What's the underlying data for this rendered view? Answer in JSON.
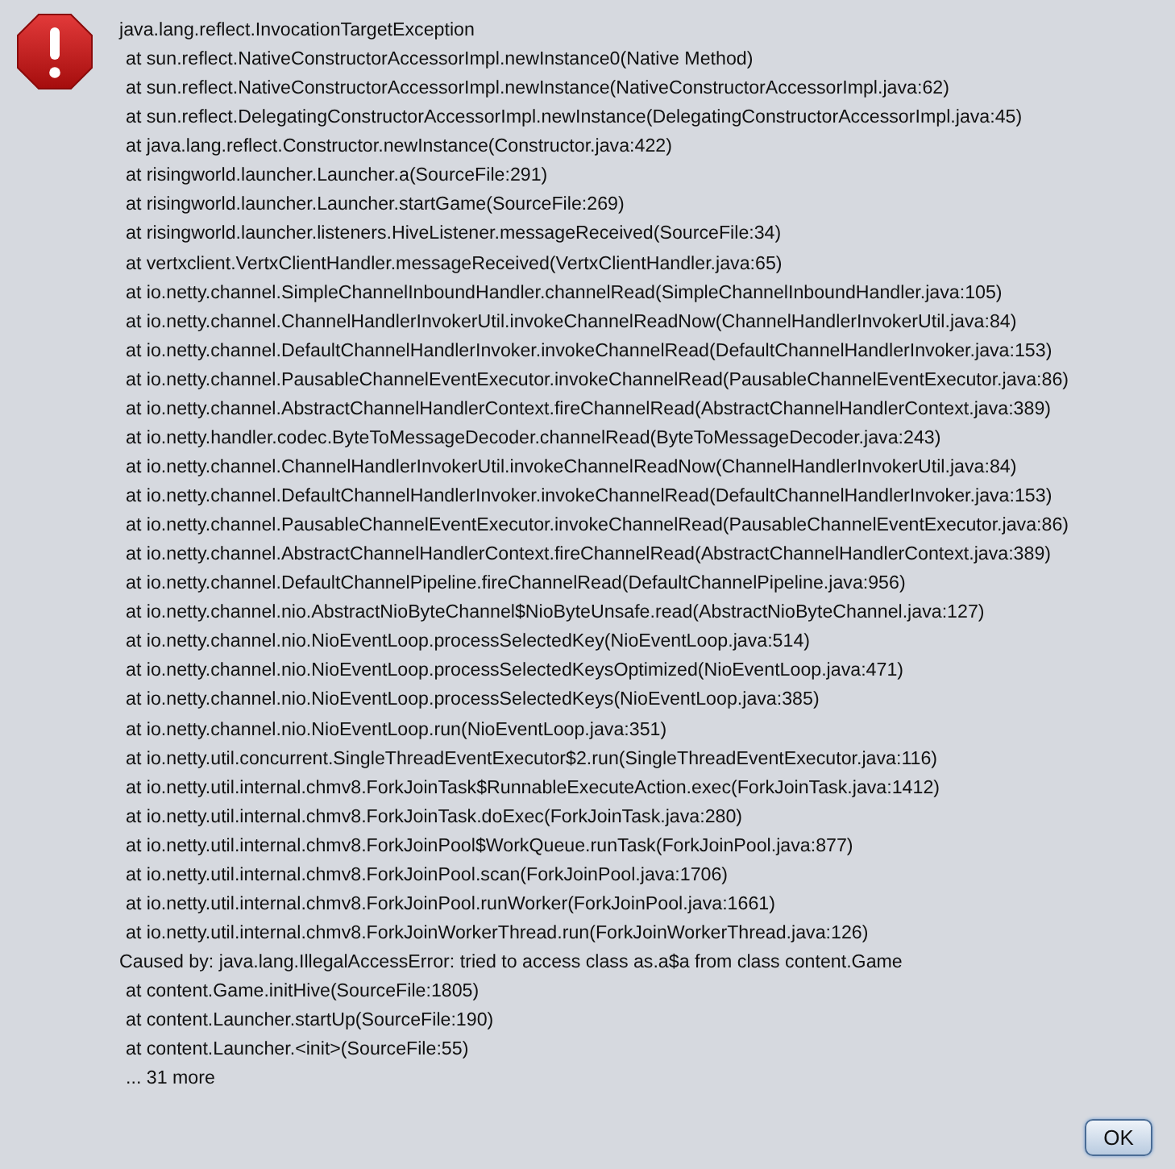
{
  "dialog": {
    "kind": "error",
    "lines": [
      {
        "kind": "exception",
        "text": "java.lang.reflect.InvocationTargetException"
      },
      {
        "kind": "frame",
        "text": "at sun.reflect.NativeConstructorAccessorImpl.newInstance0(Native Method)"
      },
      {
        "kind": "frame",
        "text": "at sun.reflect.NativeConstructorAccessorImpl.newInstance(NativeConstructorAccessorImpl.java:62)"
      },
      {
        "kind": "frame",
        "text": "at sun.reflect.DelegatingConstructorAccessorImpl.newInstance(DelegatingConstructorAccessorImpl.java:45)"
      },
      {
        "kind": "frame",
        "text": "at java.lang.reflect.Constructor.newInstance(Constructor.java:422)"
      },
      {
        "kind": "frame",
        "text": "at risingworld.launcher.Launcher.a(SourceFile:291)"
      },
      {
        "kind": "frame",
        "text": "at risingworld.launcher.Launcher.startGame(SourceFile:269)"
      },
      {
        "kind": "frame",
        "text": "at risingworld.launcher.listeners.HiveListener.messageReceived(SourceFile:34)"
      },
      {
        "kind": "frame",
        "text": "at vertxclient.VertxClientHandler.messageReceived(VertxClientHandler.java:65)"
      },
      {
        "kind": "frame",
        "text": "at io.netty.channel.SimpleChannelInboundHandler.channelRead(SimpleChannelInboundHandler.java:105)"
      },
      {
        "kind": "frame",
        "text": "at io.netty.channel.ChannelHandlerInvokerUtil.invokeChannelReadNow(ChannelHandlerInvokerUtil.java:84)"
      },
      {
        "kind": "frame",
        "text": "at io.netty.channel.DefaultChannelHandlerInvoker.invokeChannelRead(DefaultChannelHandlerInvoker.java:153)"
      },
      {
        "kind": "frame",
        "text": "at io.netty.channel.PausableChannelEventExecutor.invokeChannelRead(PausableChannelEventExecutor.java:86)"
      },
      {
        "kind": "frame",
        "text": "at io.netty.channel.AbstractChannelHandlerContext.fireChannelRead(AbstractChannelHandlerContext.java:389)"
      },
      {
        "kind": "frame",
        "text": "at io.netty.handler.codec.ByteToMessageDecoder.channelRead(ByteToMessageDecoder.java:243)"
      },
      {
        "kind": "frame",
        "text": "at io.netty.channel.ChannelHandlerInvokerUtil.invokeChannelReadNow(ChannelHandlerInvokerUtil.java:84)"
      },
      {
        "kind": "frame",
        "text": "at io.netty.channel.DefaultChannelHandlerInvoker.invokeChannelRead(DefaultChannelHandlerInvoker.java:153)"
      },
      {
        "kind": "frame",
        "text": "at io.netty.channel.PausableChannelEventExecutor.invokeChannelRead(PausableChannelEventExecutor.java:86)"
      },
      {
        "kind": "frame",
        "text": "at io.netty.channel.AbstractChannelHandlerContext.fireChannelRead(AbstractChannelHandlerContext.java:389)"
      },
      {
        "kind": "frame",
        "text": "at io.netty.channel.DefaultChannelPipeline.fireChannelRead(DefaultChannelPipeline.java:956)"
      },
      {
        "kind": "frame",
        "text": "at io.netty.channel.nio.AbstractNioByteChannel$NioByteUnsafe.read(AbstractNioByteChannel.java:127)"
      },
      {
        "kind": "frame",
        "text": "at io.netty.channel.nio.NioEventLoop.processSelectedKey(NioEventLoop.java:514)"
      },
      {
        "kind": "frame",
        "text": "at io.netty.channel.nio.NioEventLoop.processSelectedKeysOptimized(NioEventLoop.java:471)"
      },
      {
        "kind": "frame",
        "text": "at io.netty.channel.nio.NioEventLoop.processSelectedKeys(NioEventLoop.java:385)"
      },
      {
        "kind": "frame",
        "text": "at io.netty.channel.nio.NioEventLoop.run(NioEventLoop.java:351)"
      },
      {
        "kind": "frame",
        "text": "at io.netty.util.concurrent.SingleThreadEventExecutor$2.run(SingleThreadEventExecutor.java:116)"
      },
      {
        "kind": "frame",
        "text": "at io.netty.util.internal.chmv8.ForkJoinTask$RunnableExecuteAction.exec(ForkJoinTask.java:1412)"
      },
      {
        "kind": "frame",
        "text": "at io.netty.util.internal.chmv8.ForkJoinTask.doExec(ForkJoinTask.java:280)"
      },
      {
        "kind": "frame",
        "text": "at io.netty.util.internal.chmv8.ForkJoinPool$WorkQueue.runTask(ForkJoinPool.java:877)"
      },
      {
        "kind": "frame",
        "text": "at io.netty.util.internal.chmv8.ForkJoinPool.scan(ForkJoinPool.java:1706)"
      },
      {
        "kind": "frame",
        "text": "at io.netty.util.internal.chmv8.ForkJoinPool.runWorker(ForkJoinPool.java:1661)"
      },
      {
        "kind": "frame",
        "text": "at io.netty.util.internal.chmv8.ForkJoinWorkerThread.run(ForkJoinWorkerThread.java:126)"
      },
      {
        "kind": "exception",
        "text": "Caused by: java.lang.IllegalAccessError: tried to access class as.a$a from class content.Game"
      },
      {
        "kind": "frame",
        "text": "at content.Game.initHive(SourceFile:1805)"
      },
      {
        "kind": "frame",
        "text": "at content.Launcher.startUp(SourceFile:190)"
      },
      {
        "kind": "frame",
        "text": "at content.Launcher.<init>(SourceFile:55)"
      },
      {
        "kind": "frame",
        "text": "... 31 more"
      }
    ],
    "buttons": [
      "OK"
    ]
  }
}
